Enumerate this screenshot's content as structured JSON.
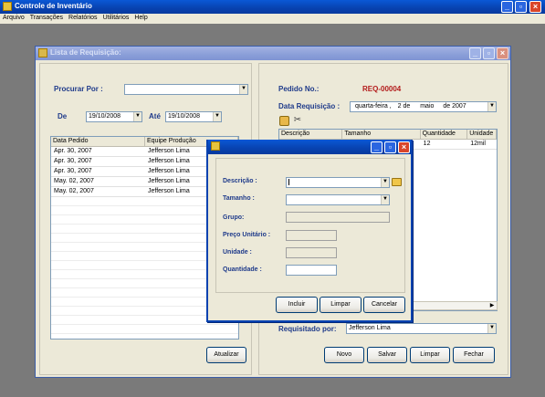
{
  "main_window": {
    "title": "Controle de Inventário",
    "menu": [
      "Arquivo",
      "Transações",
      "Relatórios",
      "Utilitários",
      "Help"
    ]
  },
  "req_window": {
    "title": "Lista de Requisição:",
    "procurar_label": "Procurar Por :",
    "procurar_value": "",
    "de_label": "De",
    "de_value": "19/10/2008",
    "ate_label": "Até",
    "ate_value": "19/10/2008",
    "list_headers": [
      "Data Pedido",
      "Equipe Produção"
    ],
    "list_rows": [
      [
        "Apr. 30, 2007",
        "Jefferson Lima"
      ],
      [
        "Apr. 30, 2007",
        "Jefferson Lima"
      ],
      [
        "Apr. 30, 2007",
        "Jefferson Lima"
      ],
      [
        "May. 02, 2007",
        "Jefferson Lima"
      ],
      [
        "May. 02, 2007",
        "Jefferson Lima"
      ]
    ],
    "atualizar_label": "Atualizar",
    "pedido_label": "Pedido No.:",
    "pedido_value": "REQ-00004",
    "data_req_label": "Data Requisição :",
    "data_req_weekday": "quarta-feira ,",
    "data_req_day": "2 de",
    "data_req_month": "maio",
    "data_req_year": "de 2007",
    "detail_headers": [
      "Descrição",
      "Tamanho",
      "Quantidade",
      "Unidade"
    ],
    "detail_row": [
      "",
      "",
      "12",
      "12mil"
    ],
    "requisitado_label": "Requisitado por:",
    "requisitado_value": "Jefferson Lima",
    "buttons": {
      "novo": "Novo",
      "salvar": "Salvar",
      "limpar": "Limpar",
      "fechar": "Fechar"
    }
  },
  "item_dialog": {
    "title": "",
    "descricao_label": "Descrição :",
    "tamanho_label": "Tamanho :",
    "grupo_label": "Grupo:",
    "preco_label": "Preço Unitário :",
    "unidade_label": "Unidade :",
    "quantidade_label": "Quantidade :",
    "buttons": {
      "incluir": "Incluir",
      "limpar": "Limpar",
      "cancelar": "Cancelar"
    }
  },
  "colors": {
    "titlebar_active": "#0842b0",
    "titlebar_inactive": "#8a9ed8",
    "label_blue": "#1e3a8a",
    "pedido_red": "#b31b1b",
    "face": "#ece9d8"
  }
}
